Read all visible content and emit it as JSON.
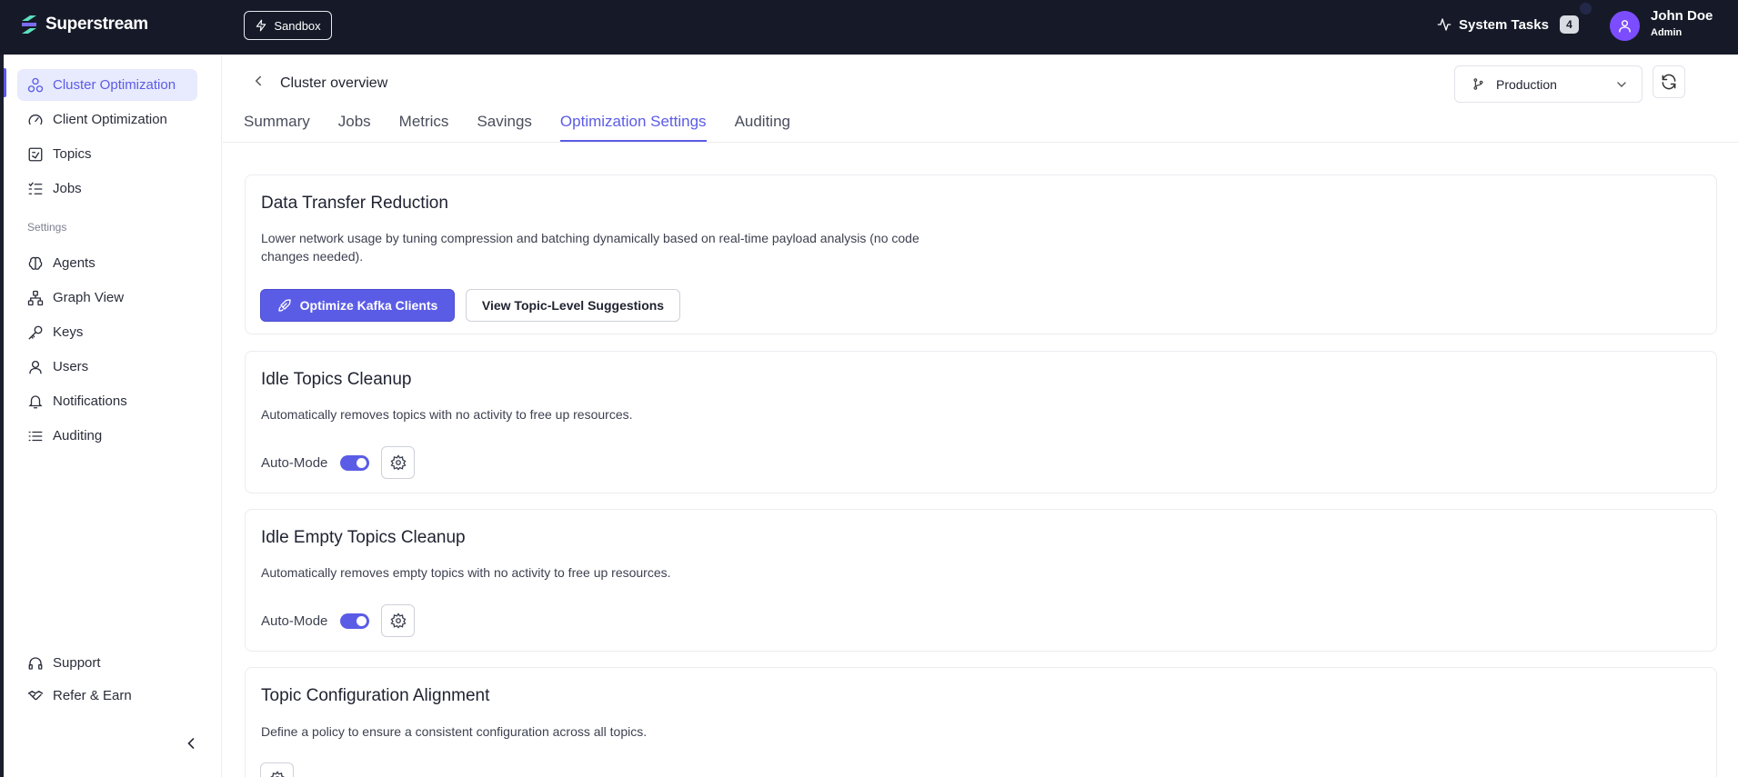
{
  "topbar": {
    "brand": "Superstream",
    "environment_mode": "Sandbox",
    "system_tasks_label": "System Tasks",
    "system_tasks_count": "4",
    "user_name": "John Doe",
    "user_role": "Admin"
  },
  "sidebar": {
    "items": [
      {
        "label": "Cluster Optimization",
        "icon": "cluster-icon",
        "active": true
      },
      {
        "label": "Client Optimization",
        "icon": "gauge-icon"
      },
      {
        "label": "Topics",
        "icon": "topics-icon"
      },
      {
        "label": "Jobs",
        "icon": "jobs-icon"
      }
    ],
    "settings_heading": "Settings",
    "settings_items": [
      {
        "label": "Agents",
        "icon": "brain-icon"
      },
      {
        "label": "Graph View",
        "icon": "graph-icon"
      },
      {
        "label": "Keys",
        "icon": "key-icon"
      },
      {
        "label": "Users",
        "icon": "user-icon"
      },
      {
        "label": "Notifications",
        "icon": "bell-icon"
      },
      {
        "label": "Auditing",
        "icon": "list-icon"
      }
    ],
    "footer_items": [
      {
        "label": "Support",
        "icon": "headset-icon"
      },
      {
        "label": "Refer & Earn",
        "icon": "handshake-icon"
      }
    ]
  },
  "header": {
    "title": "Cluster overview",
    "environment_selected": "Production"
  },
  "tabs": [
    {
      "label": "Summary"
    },
    {
      "label": "Jobs"
    },
    {
      "label": "Metrics"
    },
    {
      "label": "Savings"
    },
    {
      "label": "Optimization Settings",
      "active": true
    },
    {
      "label": "Auditing"
    }
  ],
  "cards": {
    "data_transfer": {
      "title": "Data Transfer Reduction",
      "description_line1": "Lower network usage by tuning compression and batching dynamically based on real-time payload analysis (no code",
      "description_line2": "changes needed).",
      "primary_button": "Optimize Kafka Clients",
      "secondary_button": "View Topic-Level Suggestions"
    },
    "idle_topics": {
      "title": "Idle Topics Cleanup",
      "description": "Automatically removes topics with no activity to free up resources.",
      "auto_mode_label": "Auto-Mode",
      "auto_mode_on": true
    },
    "idle_empty_topics": {
      "title": "Idle Empty Topics Cleanup",
      "description": "Automatically removes empty topics with no activity to free up resources.",
      "auto_mode_label": "Auto-Mode",
      "auto_mode_on": true
    },
    "topic_config": {
      "title": "Topic Configuration Alignment",
      "description": "Define a policy to ensure a consistent configuration across all topics."
    }
  },
  "colors": {
    "accent": "#5b5ce6",
    "topbar": "#161a28",
    "avatar": "#7c4dff"
  }
}
